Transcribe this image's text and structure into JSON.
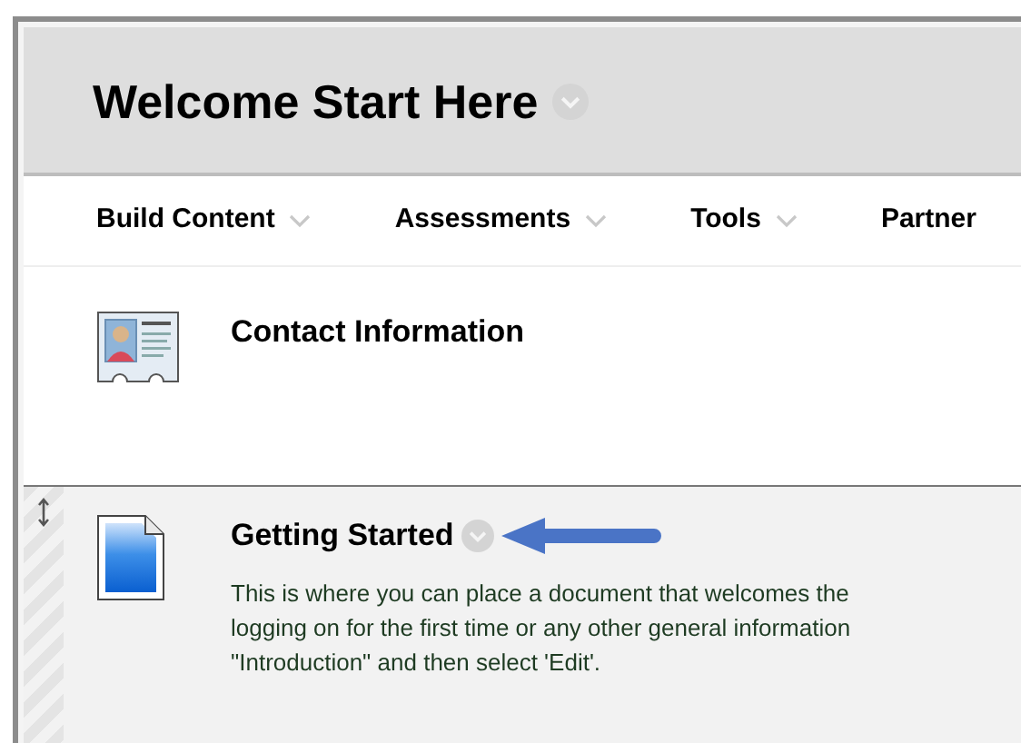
{
  "page": {
    "title": "Welcome Start Here"
  },
  "menu": [
    {
      "label": "Build Content"
    },
    {
      "label": "Assessments"
    },
    {
      "label": "Tools"
    },
    {
      "label": "Partner"
    }
  ],
  "items": [
    {
      "kind": "contact",
      "title": "Contact Information",
      "hovered": false
    },
    {
      "kind": "document",
      "title": "Getting Started",
      "hovered": true,
      "description": [
        "This is where you can place a document that welcomes the",
        "logging on for the first time or any other general information",
        "\"Introduction\" and then select 'Edit'."
      ]
    }
  ]
}
